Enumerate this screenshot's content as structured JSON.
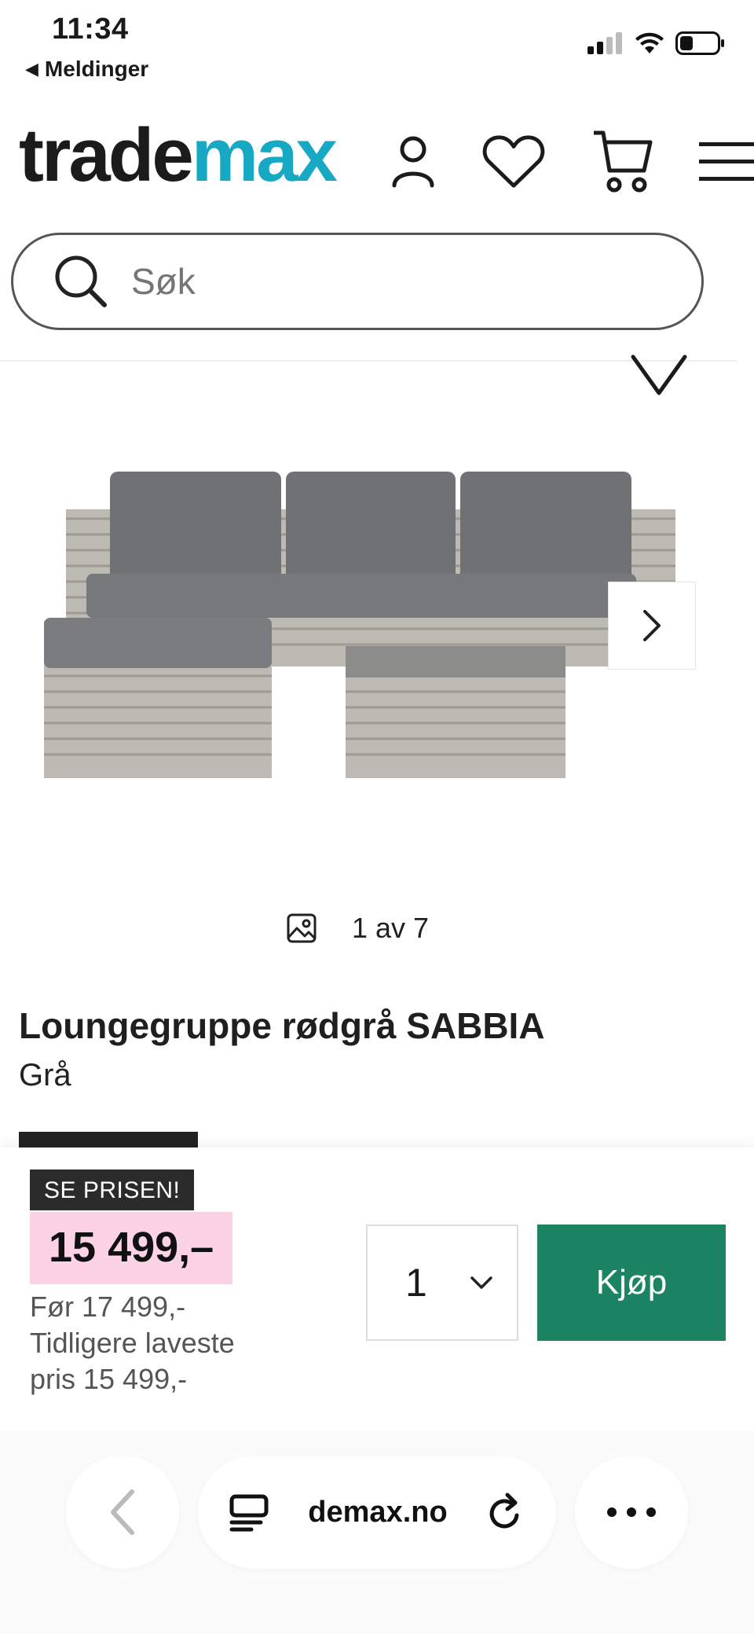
{
  "status_bar": {
    "time": "11:34",
    "back_label": "Meldinger"
  },
  "header": {
    "logo_part1": "trade",
    "logo_part2": "max",
    "logo_color": "#17a8c4"
  },
  "search": {
    "placeholder": "Søk"
  },
  "gallery": {
    "counter": "1 av 7"
  },
  "product": {
    "title": "Loungegruppe rødgrå SABBIA",
    "color": "Grå",
    "promo_badge": "SE PRISEN!",
    "price": "15 499,–",
    "old_price": "Før 17 499,-",
    "lowest_price": "Tidligere laveste pris 15 499,-"
  },
  "buy": {
    "quantity": "1",
    "buy_label": "Kjøp",
    "button_color": "#1c8462"
  },
  "browser": {
    "url": "demax.no"
  }
}
